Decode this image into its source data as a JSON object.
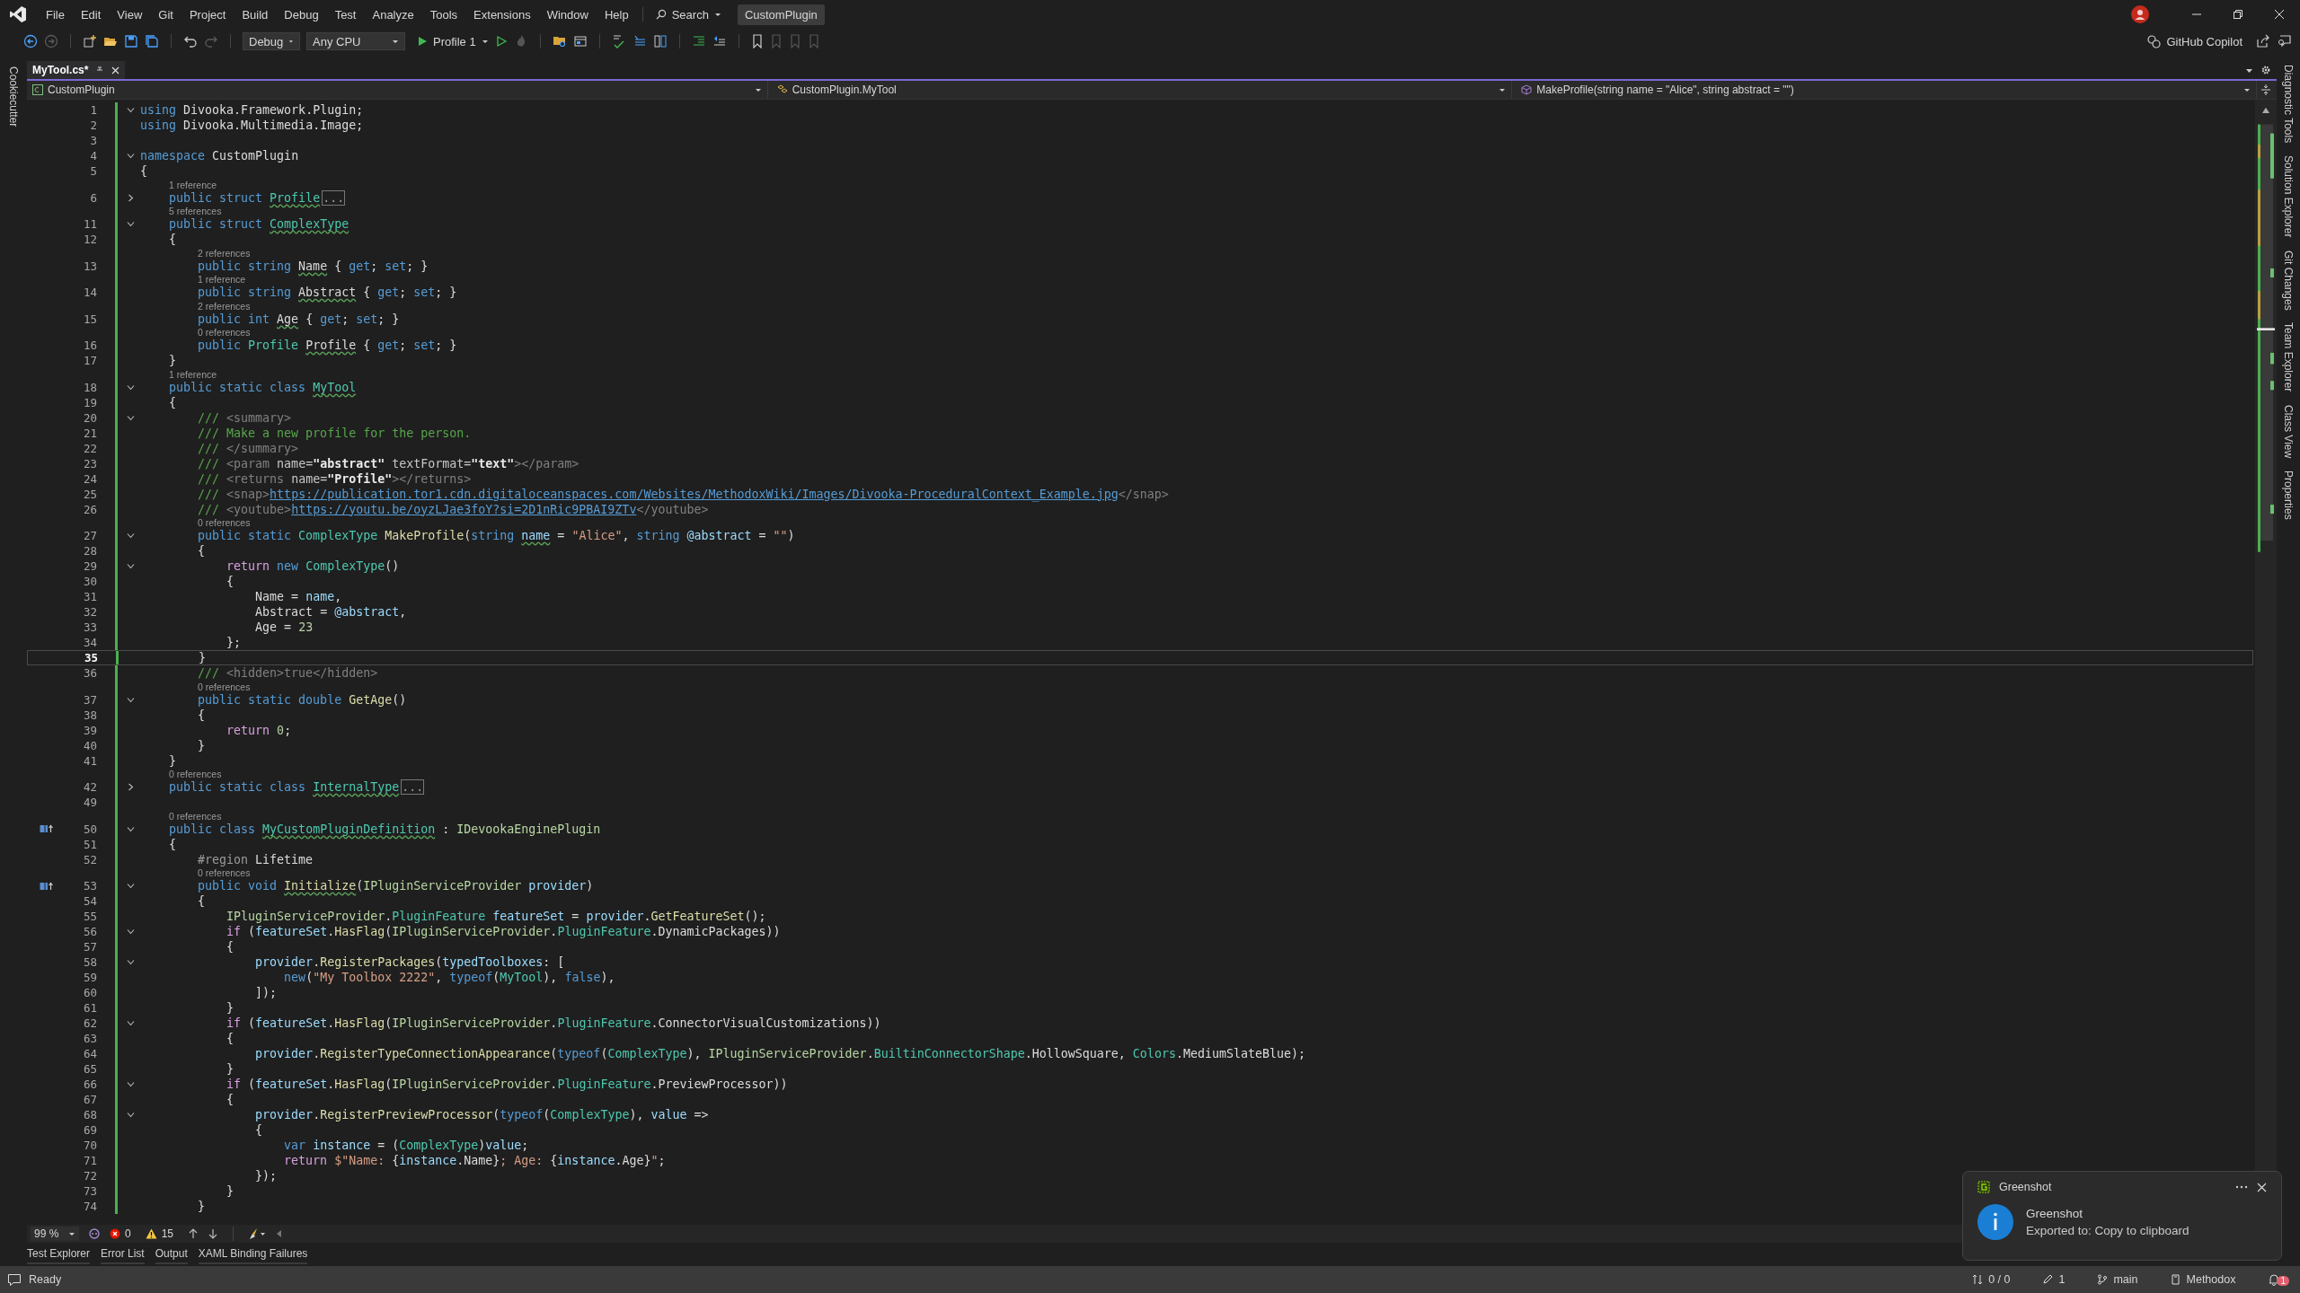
{
  "menu_bar": {
    "items": [
      "File",
      "Edit",
      "View",
      "Git",
      "Project",
      "Build",
      "Debug",
      "Test",
      "Analyze",
      "Tools",
      "Extensions",
      "Window",
      "Help"
    ],
    "search": "Search",
    "solution_name": "CustomPlugin"
  },
  "toolbar": {
    "configuration": "Debug",
    "platform": "Any CPU",
    "start_profile": "Profile 1",
    "copilot": "GitHub Copilot"
  },
  "left_panels": [
    "Cookiecutter"
  ],
  "tabs": [
    {
      "label": "MyTool.cs*",
      "selected": true
    }
  ],
  "navigation_bar": {
    "project": "CustomPlugin",
    "type": "CustomPlugin.MyTool",
    "member": "MakeProfile(string name = \"Alice\", string abstract = \"\")"
  },
  "editor": {
    "lines": [
      {
        "n": "1",
        "expanded": true,
        "s": [
          {
            "kind": "kw",
            "t": "using"
          },
          {
            "kind": "p",
            "t": " Divooka.Framework.Plugin;"
          }
        ]
      },
      {
        "n": "2",
        "s": [
          {
            "kind": "kw",
            "t": "using"
          },
          {
            "kind": "p",
            "t": " Divooka.Multimedia.Image;"
          }
        ]
      },
      {
        "n": "3"
      },
      {
        "n": "4",
        "expanded": true,
        "s": [
          {
            "kind": "kw",
            "t": "namespace"
          },
          {
            "kind": "p",
            "t": " CustomPlugin"
          }
        ]
      },
      {
        "n": "5",
        "s": [
          {
            "kind": "p",
            "t": "{"
          }
        ]
      },
      {
        "n": "6",
        "lens": "1 reference",
        "expanded": false,
        "s": [
          {
            "kind": "kw",
            "t": "    public struct "
          },
          {
            "kind": "type",
            "t": "Profile",
            "warn": true
          },
          {
            "kind": "hidden",
            "t": "..."
          }
        ]
      },
      {
        "n": "11",
        "lens": "5 references",
        "expanded": true,
        "s": [
          {
            "kind": "kw",
            "t": "    public struct "
          },
          {
            "kind": "type",
            "t": "ComplexType",
            "warn": true
          }
        ]
      },
      {
        "n": "12",
        "s": [
          {
            "kind": "p",
            "t": "    {"
          }
        ]
      },
      {
        "n": "13",
        "lens": "2 references",
        "s": [
          {
            "kind": "kw",
            "t": "        public string "
          },
          {
            "kind": "prop",
            "t": "Name",
            "warn": true
          },
          {
            "kind": "p",
            "t": " { "
          },
          {
            "kind": "kw",
            "t": "get"
          },
          {
            "kind": "p",
            "t": "; "
          },
          {
            "kind": "kw",
            "t": "set"
          },
          {
            "kind": "p",
            "t": "; }"
          }
        ]
      },
      {
        "n": "14",
        "lens": "1 reference",
        "s": [
          {
            "kind": "kw",
            "t": "        public string "
          },
          {
            "kind": "prop",
            "t": "Abstract",
            "warn": true
          },
          {
            "kind": "p",
            "t": " { "
          },
          {
            "kind": "kw",
            "t": "get"
          },
          {
            "kind": "p",
            "t": "; "
          },
          {
            "kind": "kw",
            "t": "set"
          },
          {
            "kind": "p",
            "t": "; }"
          }
        ]
      },
      {
        "n": "15",
        "lens": "2 references",
        "s": [
          {
            "kind": "kw",
            "t": "        public int "
          },
          {
            "kind": "prop",
            "t": "Age",
            "warn": true
          },
          {
            "kind": "p",
            "t": " { "
          },
          {
            "kind": "kw",
            "t": "get"
          },
          {
            "kind": "p",
            "t": "; "
          },
          {
            "kind": "kw",
            "t": "set"
          },
          {
            "kind": "p",
            "t": "; }"
          }
        ]
      },
      {
        "n": "16",
        "lens": "0 references",
        "s": [
          {
            "kind": "kw",
            "t": "        public "
          },
          {
            "kind": "type",
            "t": "Profile "
          },
          {
            "kind": "prop",
            "t": "Profile",
            "warn": true
          },
          {
            "kind": "p",
            "t": " { "
          },
          {
            "kind": "kw",
            "t": "get"
          },
          {
            "kind": "p",
            "t": "; "
          },
          {
            "kind": "kw",
            "t": "set"
          },
          {
            "kind": "p",
            "t": "; }"
          }
        ]
      },
      {
        "n": "17",
        "s": [
          {
            "kind": "p",
            "t": "    }"
          }
        ]
      },
      {
        "n": "18",
        "lens": "1 reference",
        "expanded": true,
        "s": [
          {
            "kind": "kw",
            "t": "    public static class "
          },
          {
            "kind": "type",
            "t": "MyTool",
            "warn": true
          }
        ]
      },
      {
        "n": "19",
        "s": [
          {
            "kind": "p",
            "t": "    {"
          }
        ]
      },
      {
        "n": "20",
        "expanded": true,
        "s": [
          {
            "kind": "doc",
            "t": "        /// "
          },
          {
            "kind": "dtag",
            "t": "<summary>"
          }
        ]
      },
      {
        "n": "21",
        "s": [
          {
            "kind": "doc",
            "t": "        /// Make a new profile for the person."
          }
        ]
      },
      {
        "n": "22",
        "s": [
          {
            "kind": "doc",
            "t": "        /// "
          },
          {
            "kind": "dtag",
            "t": "</summary>"
          }
        ]
      },
      {
        "n": "23",
        "s": [
          {
            "kind": "doc",
            "t": "        /// "
          },
          {
            "kind": "dtag",
            "t": "<param "
          },
          {
            "kind": "dattr",
            "t": "name="
          },
          {
            "kind": "dval",
            "t": "\"abstract\" "
          },
          {
            "kind": "dattr",
            "t": "textFormat="
          },
          {
            "kind": "dval",
            "t": "\"text\""
          },
          {
            "kind": "dtag",
            "t": "></param>"
          }
        ]
      },
      {
        "n": "24",
        "s": [
          {
            "kind": "doc",
            "t": "        /// "
          },
          {
            "kind": "dtag",
            "t": "<returns "
          },
          {
            "kind": "dattr",
            "t": "name="
          },
          {
            "kind": "dval",
            "t": "\"Profile\""
          },
          {
            "kind": "dtag",
            "t": "></returns>"
          }
        ]
      },
      {
        "n": "25",
        "s": [
          {
            "kind": "doc",
            "t": "        /// "
          },
          {
            "kind": "dtag",
            "t": "<snap>"
          },
          {
            "kind": "link",
            "t": "https://publication.tor1.cdn.digitaloceanspaces.com/Websites/MethodoxWiki/Images/Divooka-ProceduralContext_Example.jpg"
          },
          {
            "kind": "dtag",
            "t": "</snap>"
          }
        ]
      },
      {
        "n": "26",
        "s": [
          {
            "kind": "doc",
            "t": "        /// "
          },
          {
            "kind": "dtag",
            "t": "<youtube>"
          },
          {
            "kind": "link",
            "t": "https://youtu.be/oyzLJae3foY?si=2D1nRic9PBAI9ZTv"
          },
          {
            "kind": "dtag",
            "t": "</youtube>"
          }
        ]
      },
      {
        "n": "27",
        "lens": "0 references",
        "expanded": true,
        "s": [
          {
            "kind": "kw",
            "t": "        public static "
          },
          {
            "kind": "type",
            "t": "ComplexType "
          },
          {
            "kind": "method",
            "t": "MakeProfile"
          },
          {
            "kind": "p",
            "t": "("
          },
          {
            "kind": "kw",
            "t": "string "
          },
          {
            "kind": "param",
            "t": "name",
            "warn": true
          },
          {
            "kind": "p",
            "t": " = "
          },
          {
            "kind": "str",
            "t": "\"Alice\""
          },
          {
            "kind": "p",
            "t": ", "
          },
          {
            "kind": "kw",
            "t": "string "
          },
          {
            "kind": "param",
            "t": "@abstract"
          },
          {
            "kind": "p",
            "t": " = "
          },
          {
            "kind": "str",
            "t": "\"\""
          },
          {
            "kind": "p",
            "t": ")"
          }
        ]
      },
      {
        "n": "28",
        "s": [
          {
            "kind": "p",
            "t": "        {"
          }
        ]
      },
      {
        "n": "29",
        "expanded": true,
        "s": [
          {
            "kind": "ctl",
            "t": "            return "
          },
          {
            "kind": "kw",
            "t": "new "
          },
          {
            "kind": "type",
            "t": "ComplexType"
          },
          {
            "kind": "p",
            "t": "()"
          }
        ]
      },
      {
        "n": "30",
        "s": [
          {
            "kind": "p",
            "t": "            {"
          }
        ]
      },
      {
        "n": "31",
        "s": [
          {
            "kind": "prop",
            "t": "                Name"
          },
          {
            "kind": "p",
            "t": " = "
          },
          {
            "kind": "param",
            "t": "name"
          },
          {
            "kind": "p",
            "t": ","
          }
        ]
      },
      {
        "n": "32",
        "s": [
          {
            "kind": "prop",
            "t": "                Abstract"
          },
          {
            "kind": "p",
            "t": " = "
          },
          {
            "kind": "param",
            "t": "@abstract"
          },
          {
            "kind": "p",
            "t": ","
          }
        ]
      },
      {
        "n": "33",
        "s": [
          {
            "kind": "prop",
            "t": "                Age"
          },
          {
            "kind": "p",
            "t": " = "
          },
          {
            "kind": "num",
            "t": "23"
          }
        ]
      },
      {
        "n": "34",
        "s": [
          {
            "kind": "p",
            "t": "            };"
          }
        ]
      },
      {
        "n": "35",
        "current": true,
        "s": [
          {
            "kind": "p",
            "t": "        }"
          }
        ]
      },
      {
        "n": "36",
        "s": [
          {
            "kind": "doc",
            "t": "        /// "
          },
          {
            "kind": "dtag",
            "t": "<hidden>true</hidden>"
          }
        ]
      },
      {
        "n": "37",
        "lens": "0 references",
        "expanded": true,
        "s": [
          {
            "kind": "kw",
            "t": "        public static double "
          },
          {
            "kind": "method",
            "t": "GetAge"
          },
          {
            "kind": "p",
            "t": "()"
          }
        ]
      },
      {
        "n": "38",
        "s": [
          {
            "kind": "p",
            "t": "        {"
          }
        ]
      },
      {
        "n": "39",
        "s": [
          {
            "kind": "ctl",
            "t": "            return "
          },
          {
            "kind": "num",
            "t": "0"
          },
          {
            "kind": "p",
            "t": ";"
          }
        ]
      },
      {
        "n": "40",
        "s": [
          {
            "kind": "p",
            "t": "        }"
          }
        ]
      },
      {
        "n": "41",
        "s": [
          {
            "kind": "p",
            "t": "    }"
          }
        ]
      },
      {
        "n": "42",
        "lens": "0 references",
        "expanded": false,
        "s": [
          {
            "kind": "kw",
            "t": "    public static class "
          },
          {
            "kind": "type",
            "t": "InternalType",
            "warn": true
          },
          {
            "kind": "hidden",
            "t": "..."
          }
        ]
      },
      {
        "n": "49"
      },
      {
        "n": "50",
        "lens": "0 references",
        "expanded": true,
        "implements": true,
        "s": [
          {
            "kind": "kw",
            "t": "    public class "
          },
          {
            "kind": "type",
            "t": "MyCustomPluginDefinition",
            "warn": true
          },
          {
            "kind": "p",
            "t": " : "
          },
          {
            "kind": "iface",
            "t": "IDevookaEnginePlugin"
          }
        ]
      },
      {
        "n": "51",
        "s": [
          {
            "kind": "p",
            "t": "    {"
          }
        ]
      },
      {
        "n": "52",
        "s": [
          {
            "kind": "region",
            "t": "        #region"
          },
          {
            "kind": "p",
            "t": " Lifetime"
          }
        ]
      },
      {
        "n": "53",
        "lens": "0 references",
        "expanded": true,
        "implements": true,
        "s": [
          {
            "kind": "kw",
            "t": "        public void "
          },
          {
            "kind": "method",
            "t": "Initialize",
            "warn": true
          },
          {
            "kind": "p",
            "t": "("
          },
          {
            "kind": "iface",
            "t": "IPluginServiceProvider "
          },
          {
            "kind": "param",
            "t": "provider"
          },
          {
            "kind": "p",
            "t": ")"
          }
        ]
      },
      {
        "n": "54",
        "s": [
          {
            "kind": "p",
            "t": "        {"
          }
        ]
      },
      {
        "n": "55",
        "s": [
          {
            "kind": "iface",
            "t": "            IPluginServiceProvider"
          },
          {
            "kind": "p",
            "t": "."
          },
          {
            "kind": "type",
            "t": "PluginFeature "
          },
          {
            "kind": "param",
            "t": "featureSet"
          },
          {
            "kind": "p",
            "t": " = "
          },
          {
            "kind": "param",
            "t": "provider"
          },
          {
            "kind": "p",
            "t": "."
          },
          {
            "kind": "method",
            "t": "GetFeatureSet"
          },
          {
            "kind": "p",
            "t": "();"
          }
        ]
      },
      {
        "n": "56",
        "expanded": true,
        "s": [
          {
            "kind": "ctl",
            "t": "            if"
          },
          {
            "kind": "p",
            "t": " ("
          },
          {
            "kind": "param",
            "t": "featureSet"
          },
          {
            "kind": "p",
            "t": "."
          },
          {
            "kind": "method",
            "t": "HasFlag"
          },
          {
            "kind": "p",
            "t": "("
          },
          {
            "kind": "iface",
            "t": "IPluginServiceProvider"
          },
          {
            "kind": "p",
            "t": "."
          },
          {
            "kind": "type",
            "t": "PluginFeature"
          },
          {
            "kind": "p",
            "t": ".DynamicPackages))"
          }
        ]
      },
      {
        "n": "57",
        "s": [
          {
            "kind": "p",
            "t": "            {"
          }
        ]
      },
      {
        "n": "58",
        "expanded": true,
        "s": [
          {
            "kind": "param",
            "t": "                provider"
          },
          {
            "kind": "p",
            "t": "."
          },
          {
            "kind": "method",
            "t": "RegisterPackages"
          },
          {
            "kind": "p",
            "t": "("
          },
          {
            "kind": "param",
            "t": "typedToolboxes"
          },
          {
            "kind": "p",
            "t": ": ["
          }
        ]
      },
      {
        "n": "59",
        "s": [
          {
            "kind": "kw",
            "t": "                    new"
          },
          {
            "kind": "p",
            "t": "("
          },
          {
            "kind": "str",
            "t": "\"My Toolbox 2222\""
          },
          {
            "kind": "p",
            "t": ", "
          },
          {
            "kind": "kw",
            "t": "typeof"
          },
          {
            "kind": "p",
            "t": "("
          },
          {
            "kind": "type",
            "t": "MyTool"
          },
          {
            "kind": "p",
            "t": "), "
          },
          {
            "kind": "kw",
            "t": "false"
          },
          {
            "kind": "p",
            "t": "),"
          }
        ]
      },
      {
        "n": "60",
        "s": [
          {
            "kind": "p",
            "t": "                ]);"
          }
        ]
      },
      {
        "n": "61",
        "s": [
          {
            "kind": "p",
            "t": "            }"
          }
        ]
      },
      {
        "n": "62",
        "expanded": true,
        "s": [
          {
            "kind": "ctl",
            "t": "            if"
          },
          {
            "kind": "p",
            "t": " ("
          },
          {
            "kind": "param",
            "t": "featureSet"
          },
          {
            "kind": "p",
            "t": "."
          },
          {
            "kind": "method",
            "t": "HasFlag"
          },
          {
            "kind": "p",
            "t": "("
          },
          {
            "kind": "iface",
            "t": "IPluginServiceProvider"
          },
          {
            "kind": "p",
            "t": "."
          },
          {
            "kind": "type",
            "t": "PluginFeature"
          },
          {
            "kind": "p",
            "t": ".ConnectorVisualCustomizations))"
          }
        ]
      },
      {
        "n": "63",
        "s": [
          {
            "kind": "p",
            "t": "            {"
          }
        ]
      },
      {
        "n": "64",
        "s": [
          {
            "kind": "param",
            "t": "                provider"
          },
          {
            "kind": "p",
            "t": "."
          },
          {
            "kind": "method",
            "t": "RegisterTypeConnectionAppearance"
          },
          {
            "kind": "p",
            "t": "("
          },
          {
            "kind": "kw",
            "t": "typeof"
          },
          {
            "kind": "p",
            "t": "("
          },
          {
            "kind": "type",
            "t": "ComplexType"
          },
          {
            "kind": "p",
            "t": "), "
          },
          {
            "kind": "iface",
            "t": "IPluginServiceProvider"
          },
          {
            "kind": "p",
            "t": "."
          },
          {
            "kind": "type",
            "t": "BuiltinConnectorShape"
          },
          {
            "kind": "p",
            "t": ".HollowSquare, "
          },
          {
            "kind": "type",
            "t": "Colors"
          },
          {
            "kind": "p",
            "t": ".MediumSlateBlue);"
          }
        ]
      },
      {
        "n": "65",
        "s": [
          {
            "kind": "p",
            "t": "            }"
          }
        ]
      },
      {
        "n": "66",
        "expanded": true,
        "s": [
          {
            "kind": "ctl",
            "t": "            if"
          },
          {
            "kind": "p",
            "t": " ("
          },
          {
            "kind": "param",
            "t": "featureSet"
          },
          {
            "kind": "p",
            "t": "."
          },
          {
            "kind": "method",
            "t": "HasFlag"
          },
          {
            "kind": "p",
            "t": "("
          },
          {
            "kind": "iface",
            "t": "IPluginServiceProvider"
          },
          {
            "kind": "p",
            "t": "."
          },
          {
            "kind": "type",
            "t": "PluginFeature"
          },
          {
            "kind": "p",
            "t": ".PreviewProcessor))"
          }
        ]
      },
      {
        "n": "67",
        "s": [
          {
            "kind": "p",
            "t": "            {"
          }
        ]
      },
      {
        "n": "68",
        "expanded": true,
        "s": [
          {
            "kind": "param",
            "t": "                provider"
          },
          {
            "kind": "p",
            "t": "."
          },
          {
            "kind": "method",
            "t": "RegisterPreviewProcessor"
          },
          {
            "kind": "p",
            "t": "("
          },
          {
            "kind": "kw",
            "t": "typeof"
          },
          {
            "kind": "p",
            "t": "("
          },
          {
            "kind": "type",
            "t": "ComplexType"
          },
          {
            "kind": "p",
            "t": "), "
          },
          {
            "kind": "param",
            "t": "value"
          },
          {
            "kind": "p",
            "t": " =>"
          }
        ]
      },
      {
        "n": "69",
        "s": [
          {
            "kind": "p",
            "t": "                {"
          }
        ]
      },
      {
        "n": "70",
        "s": [
          {
            "kind": "kw",
            "t": "                    var "
          },
          {
            "kind": "param",
            "t": "instance"
          },
          {
            "kind": "p",
            "t": " = ("
          },
          {
            "kind": "type",
            "t": "ComplexType"
          },
          {
            "kind": "p",
            "t": ")"
          },
          {
            "kind": "param",
            "t": "value"
          },
          {
            "kind": "p",
            "t": ";"
          }
        ]
      },
      {
        "n": "71",
        "s": [
          {
            "kind": "ctl",
            "t": "                    return "
          },
          {
            "kind": "str",
            "t": "$\"Name: "
          },
          {
            "kind": "p",
            "t": "{"
          },
          {
            "kind": "param",
            "t": "instance"
          },
          {
            "kind": "p",
            "t": ".Name}"
          },
          {
            "kind": "str",
            "t": "; Age: "
          },
          {
            "kind": "p",
            "t": "{"
          },
          {
            "kind": "param",
            "t": "instance"
          },
          {
            "kind": "p",
            "t": ".Age}"
          },
          {
            "kind": "str",
            "t": "\""
          },
          {
            "kind": "p",
            "t": ";"
          }
        ]
      },
      {
        "n": "72",
        "s": [
          {
            "kind": "p",
            "t": "                });"
          }
        ]
      },
      {
        "n": "73",
        "s": [
          {
            "kind": "p",
            "t": "            }"
          }
        ]
      },
      {
        "n": "74",
        "s": [
          {
            "kind": "p",
            "t": "        }"
          }
        ]
      }
    ]
  },
  "right_panels": [
    "Diagnostic Tools",
    "Solution Explorer",
    "Git Changes",
    "Team Explorer",
    "Class View",
    "Properties"
  ],
  "editor_status": {
    "zoom": "99 %",
    "errors": "0",
    "warnings": "15"
  },
  "tool_tabs": [
    "Test Explorer",
    "Error List",
    "Output",
    "XAML Binding Failures"
  ],
  "status_bar": {
    "text": "Ready",
    "changes": "0 / 0",
    "edits": "1",
    "branch": "main",
    "repository": "Methodox",
    "notifications": "1"
  },
  "notification": {
    "app": "Greenshot",
    "title": "Greenshot",
    "message": "Exported to: Copy to clipboard"
  }
}
